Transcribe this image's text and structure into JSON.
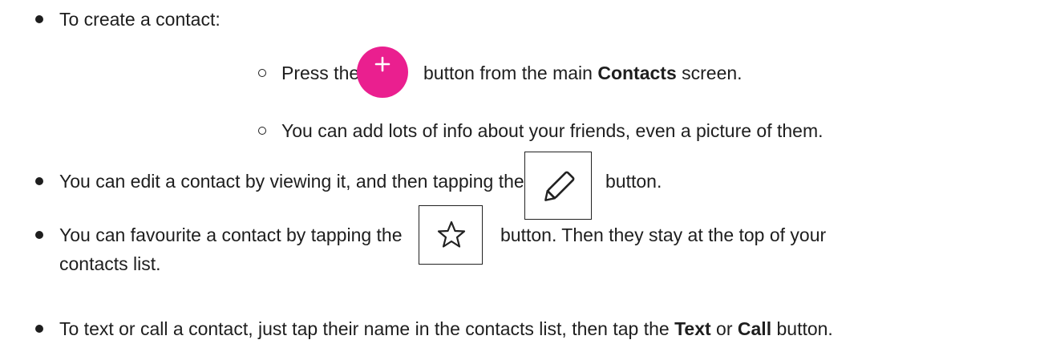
{
  "items": {
    "create": {
      "text": "To create a contact:"
    },
    "press": {
      "before": "Press the",
      "after_prefix": "button from the main ",
      "bold": "Contacts",
      "after_suffix": " screen."
    },
    "info": {
      "text": "You can add lots of info about your friends, even a picture of them."
    },
    "edit": {
      "before": "You can edit a contact by viewing it, and then tapping the",
      "after": "button."
    },
    "favourite": {
      "before": "You can favourite a contact by tapping the",
      "after": "button. Then they stay at the top of your",
      "continuation": "contacts list."
    },
    "text_call": {
      "prefix": "To text or call a contact, just tap their name in the contacts list, then tap the ",
      "bold1": "Text",
      "middle": " or ",
      "bold2": "Call",
      "suffix": " button."
    }
  },
  "icons": {
    "add": "plus-icon",
    "edit": "pencil-icon",
    "favourite": "star-icon"
  },
  "colors": {
    "add_button": "#ea1f8f",
    "text": "#1e1e1e"
  }
}
